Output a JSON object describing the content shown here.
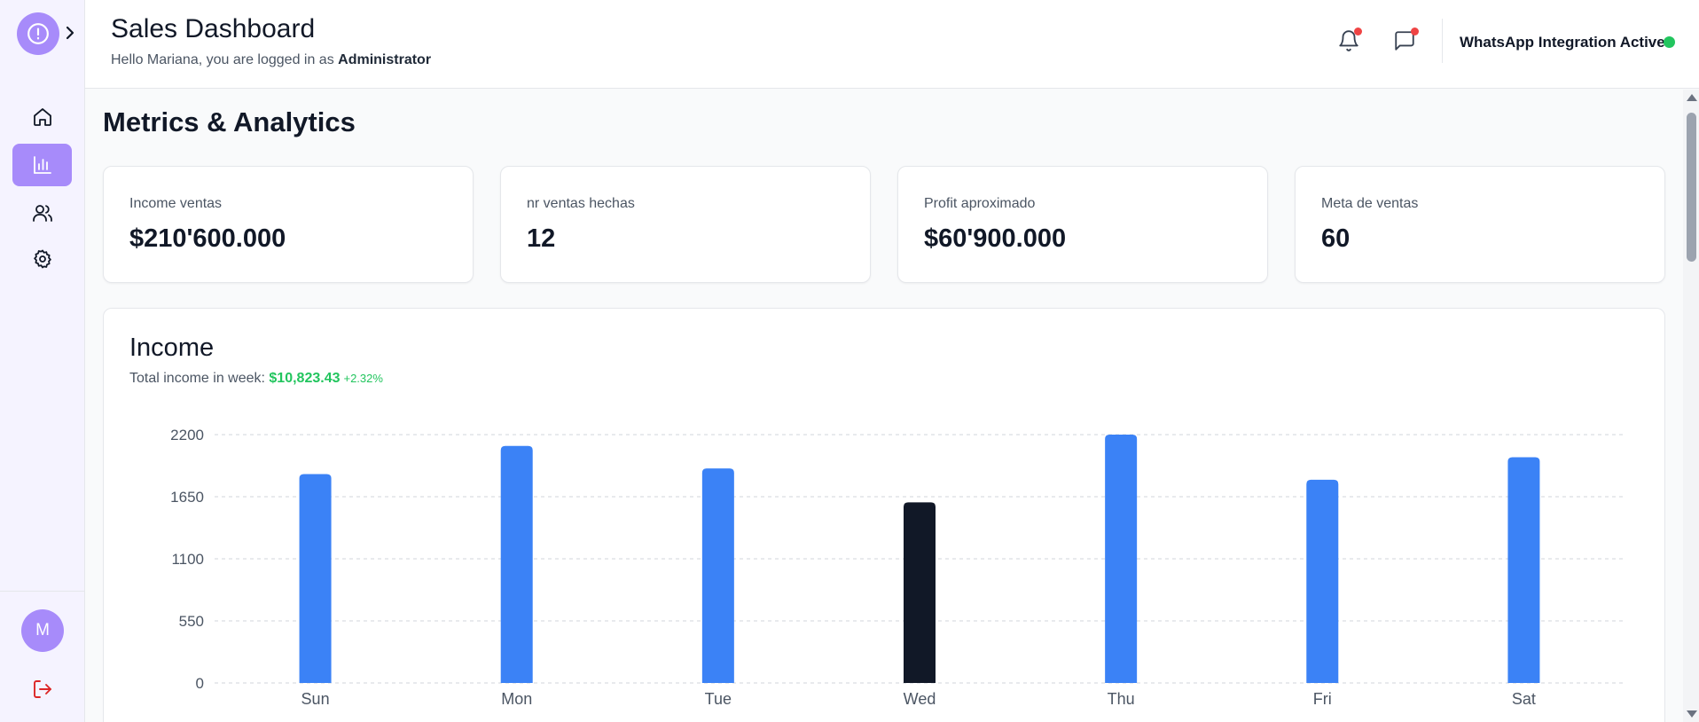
{
  "header": {
    "title": "Sales Dashboard",
    "greeting_prefix": "Hello Mariana, you are logged in as ",
    "role": "Administrator",
    "whatsapp_status": "WhatsApp Integration Active"
  },
  "sidebar": {
    "logo_icon": "alert-circle-icon",
    "items": [
      {
        "name": "home",
        "icon": "home-icon"
      },
      {
        "name": "analytics",
        "icon": "bar-chart-icon",
        "active": true
      },
      {
        "name": "users",
        "icon": "users-icon"
      },
      {
        "name": "settings",
        "icon": "gear-icon"
      }
    ],
    "avatar_initial": "M"
  },
  "page": {
    "title": "Metrics & Analytics"
  },
  "metrics": [
    {
      "label": "Income ventas",
      "value": "$210'600.000"
    },
    {
      "label": "nr ventas hechas",
      "value": "12"
    },
    {
      "label": "Profit aproximado",
      "value": "$60'900.000"
    },
    {
      "label": "Meta de ventas",
      "value": "60"
    }
  ],
  "income": {
    "title": "Income",
    "subtitle_prefix": "Total income in week: ",
    "total": "$10,823.43",
    "change": "+2.32%"
  },
  "colors": {
    "accent": "#a78bfa",
    "bar": "#3b82f6",
    "bar_highlight": "#111827",
    "positive": "#22c55e",
    "alert": "#ef4444"
  },
  "chart_data": {
    "type": "bar",
    "categories": [
      "Sun",
      "Mon",
      "Tue",
      "Wed",
      "Thu",
      "Fri",
      "Sat"
    ],
    "values": [
      1850,
      2100,
      1900,
      1600,
      2200,
      1800,
      2000
    ],
    "highlight_index": 3,
    "yticks": [
      0,
      550,
      1100,
      1650,
      2200
    ],
    "ylim": [
      0,
      2200
    ],
    "grid": true,
    "title": "",
    "xlabel": "",
    "ylabel": ""
  }
}
